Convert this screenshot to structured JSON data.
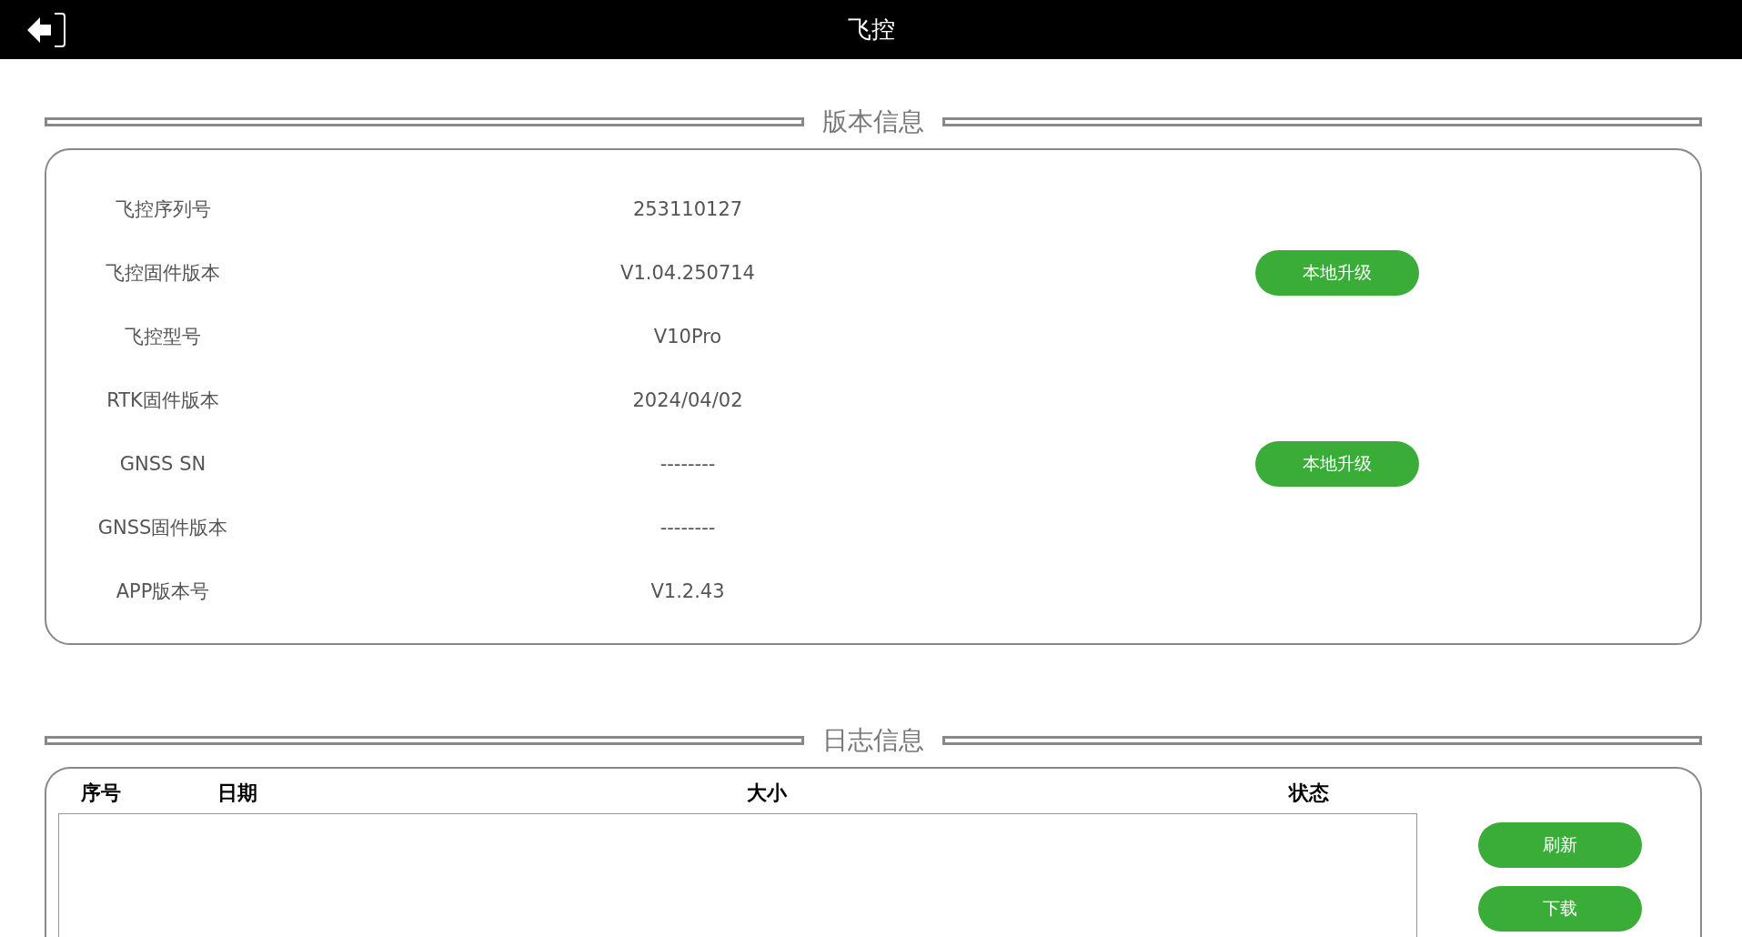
{
  "header": {
    "title": "飞控"
  },
  "version_info": {
    "title": "版本信息",
    "rows": [
      {
        "label": "飞控序列号",
        "value": "253110127"
      },
      {
        "label": "飞控固件版本",
        "value": "V1.04.250714",
        "button": "本地升级"
      },
      {
        "label": "飞控型号",
        "value": "V10Pro"
      },
      {
        "label": "RTK固件版本",
        "value": "2024/04/02"
      },
      {
        "label": "GNSS SN",
        "value": "--------",
        "button": "本地升级"
      },
      {
        "label": "GNSS固件版本",
        "value": "--------"
      },
      {
        "label": "APP版本号",
        "value": "V1.2.43"
      }
    ]
  },
  "log_info": {
    "title": "日志信息",
    "table": {
      "columns": [
        "序号",
        "日期",
        "大小",
        "状态"
      ]
    },
    "buttons": [
      "刷新",
      "下载"
    ]
  }
}
